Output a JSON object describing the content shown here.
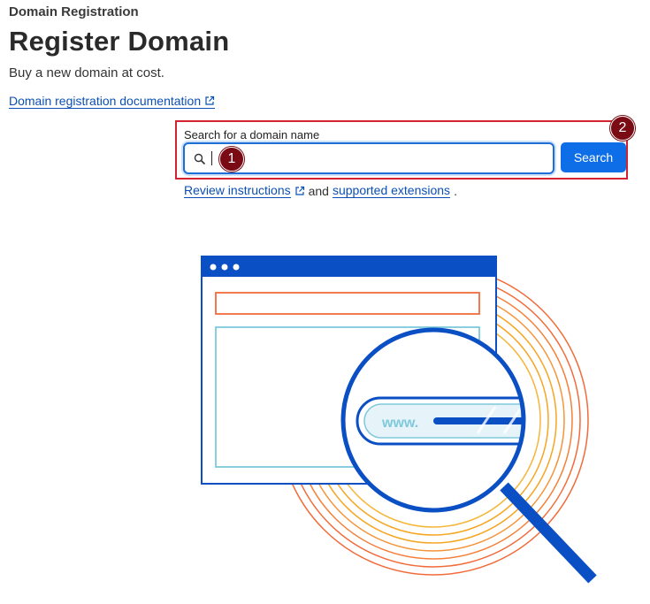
{
  "header": {
    "breadcrumb": "Domain Registration",
    "title": "Register Domain",
    "subtitle": "Buy a new domain at cost.",
    "doc_link": "Domain registration documentation"
  },
  "search": {
    "label": "Search for a domain name",
    "value": "",
    "button_label": "Search"
  },
  "helper": {
    "review_link": "Review instructions",
    "and_text": "and",
    "extensions_link": "supported extensions",
    "period": "."
  },
  "illustration": {
    "url_text": "www."
  },
  "annotations": {
    "badge_1": "1",
    "badge_2": "2"
  },
  "colors": {
    "accent": "#0d6ee8",
    "link": "#0b4fb4",
    "highlight_box": "#d42330",
    "badge": "#7a0a13",
    "ring_orange": "#f26b3a",
    "ring_yellow": "#f5a623",
    "illus_blue": "#0b4fc4",
    "illus_teal": "#7ec9dc"
  }
}
